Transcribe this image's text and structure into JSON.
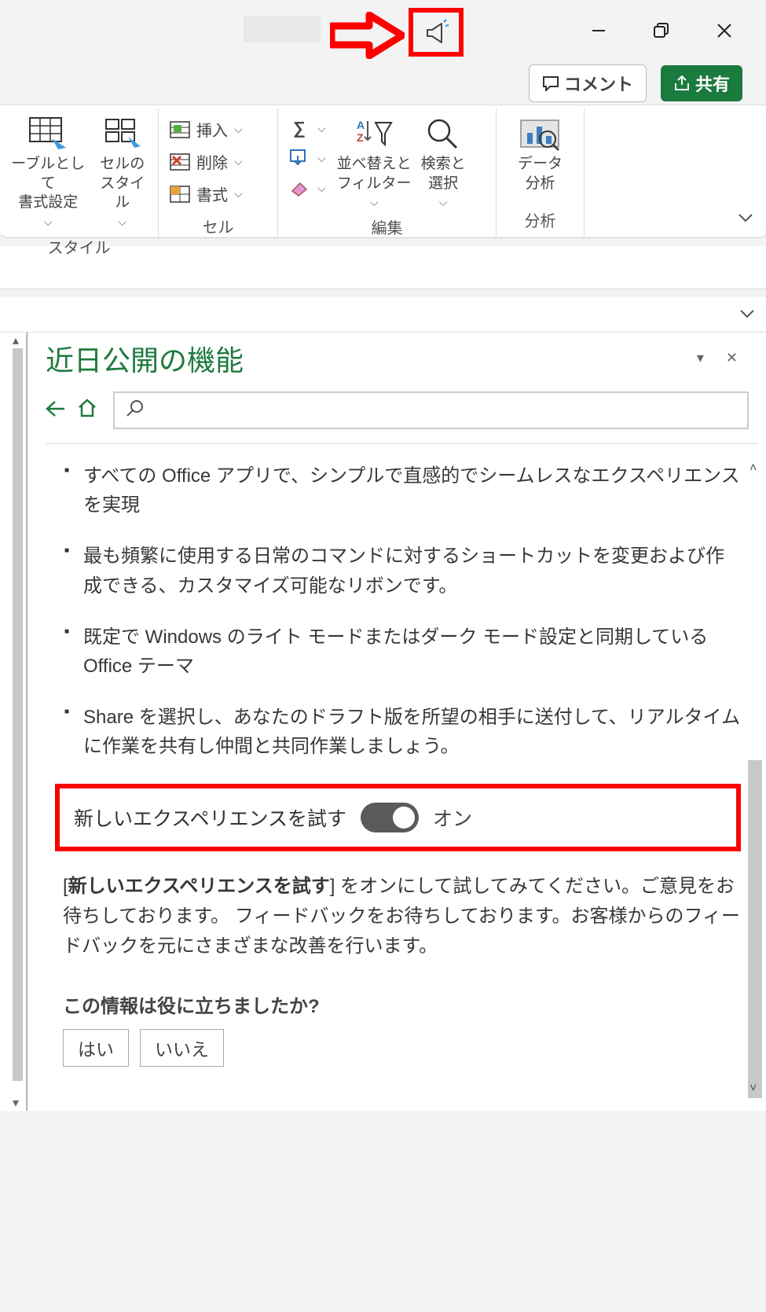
{
  "window": {
    "minimize": "—",
    "maximize": "❐",
    "close": "✕"
  },
  "actions": {
    "comment": "コメント",
    "share": "共有"
  },
  "ribbon": {
    "styles": {
      "format_table": "ーブルとして\n書式設定",
      "cell_styles": "セルの\nスタイル",
      "group": "スタイル"
    },
    "cells": {
      "insert": "挿入",
      "delete": "削除",
      "format": "書式",
      "group": "セル"
    },
    "editing": {
      "sort_filter": "並べ替えと\nフィルター",
      "find_select": "検索と\n選択",
      "group": "編集"
    },
    "analysis": {
      "data_analysis": "データ\n分析",
      "group": "分析"
    }
  },
  "pane": {
    "title": "近日公開の機能",
    "bullets": [
      "すべての Office アプリで、シンプルで直感的でシームレスなエクスペリエンスを実現",
      "最も頻繁に使用する日常のコマンドに対するショートカットを変更および作成できる、カスタマイズ可能なリボンです。",
      "既定で Windows のライト モードまたはダーク モード設定と同期している Office テーマ",
      "Share を選択し、あなたのドラフト版を所望の相手に送付して、リアルタイムに作業を共有し仲間と共同作業しましょう。"
    ],
    "toggle_label": "新しいエクスペリエンスを試す",
    "toggle_state": "オン",
    "para_bold": "新しいエクスペリエンスを試す",
    "para_rest": "] をオンにして試してみてください。ご意見をお待ちしております。 フィードバックをお待ちしております。お客様からのフィードバックを元にさまざまな改善を行います。",
    "feedback_q": "この情報は役に立ちましたか?",
    "yes": "はい",
    "no": "いいえ"
  }
}
